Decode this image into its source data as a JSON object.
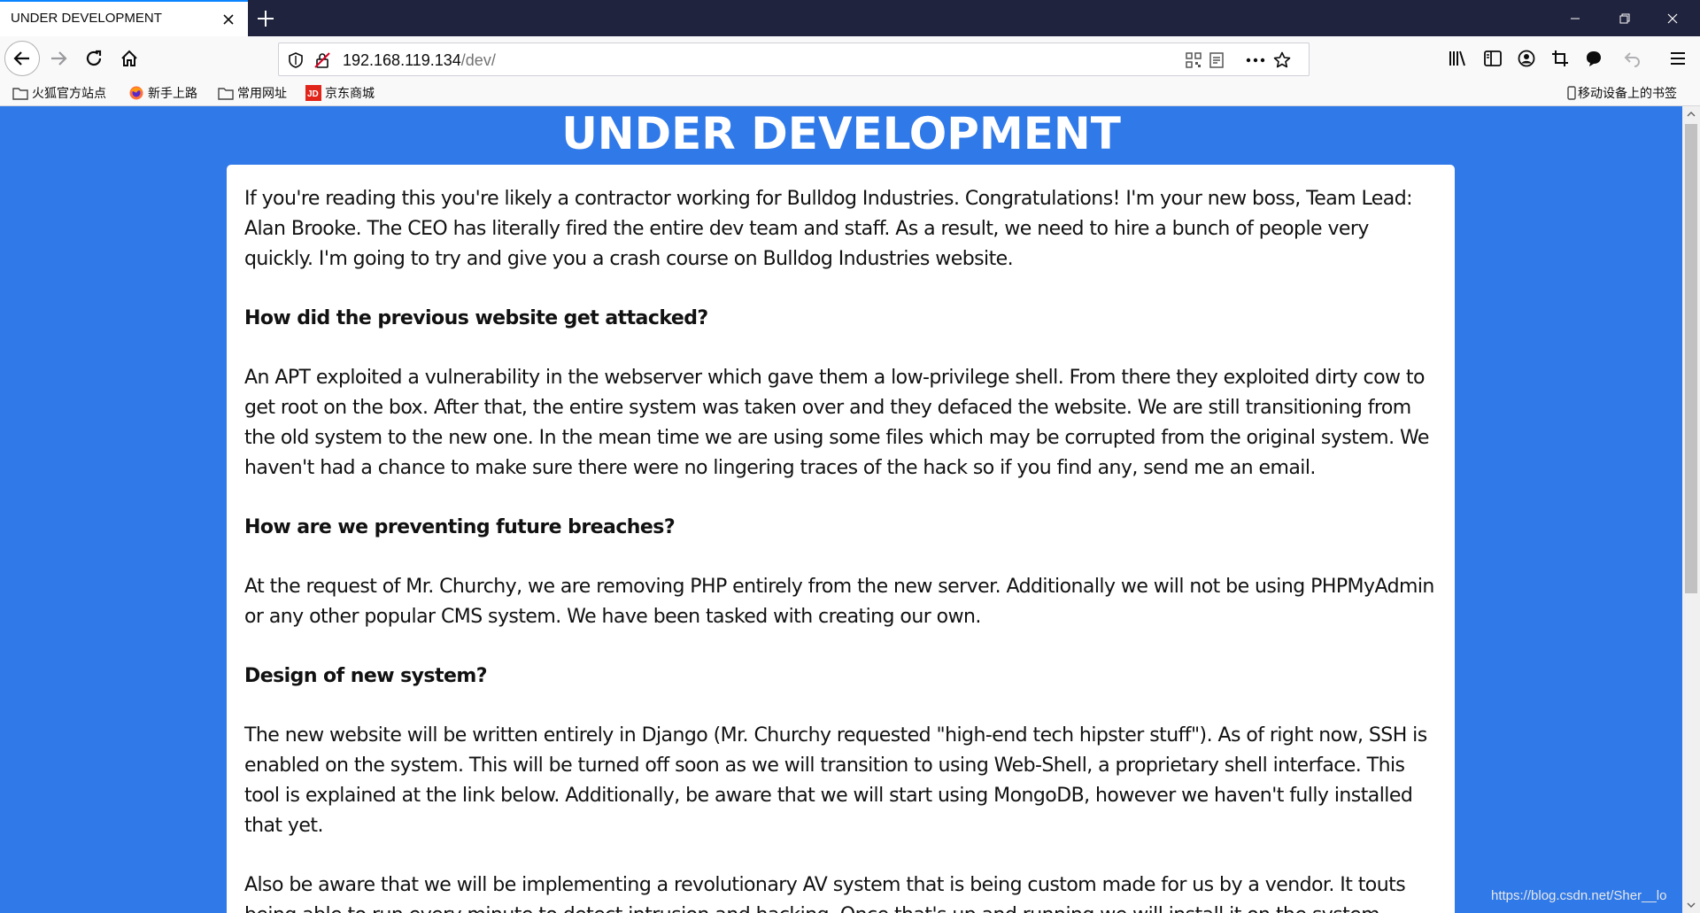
{
  "browser": {
    "tab_title": "UNDER DEVELOPMENT",
    "url_host": "192.168.119.134",
    "url_path": "/dev/"
  },
  "bookmarks": [
    {
      "label": "火狐官方站点",
      "icon": "folder-icon"
    },
    {
      "label": "新手上路",
      "icon": "firefox-icon"
    },
    {
      "label": "常用网址",
      "icon": "folder-icon"
    },
    {
      "label": "京东商城",
      "icon": "jd-icon"
    }
  ],
  "mobile_bookmarks": "移动设备上的书签",
  "page": {
    "title": "UNDER DEVELOPMENT",
    "blocks": [
      {
        "type": "p",
        "text": "If you're reading this you're likely a contractor working for Bulldog Industries. Congratulations! I'm your new boss, Team Lead: Alan Brooke. The CEO has literally fired the entire dev team and staff. As a result, we need to hire a bunch of people very quickly. I'm going to try and give you a crash course on Bulldog Industries website."
      },
      {
        "type": "h",
        "text": "How did the previous website get attacked?"
      },
      {
        "type": "p",
        "text": "An APT exploited a vulnerability in the webserver which gave them a low-privilege shell. From there they exploited dirty cow to get root on the box. After that, the entire system was taken over and they defaced the website. We are still transitioning from the old system to the new one. In the mean time we are using some files which may be corrupted from the original system. We haven't had a chance to make sure there were no lingering traces of the hack so if you find any, send me an email."
      },
      {
        "type": "h",
        "text": "How are we preventing future breaches?"
      },
      {
        "type": "p",
        "text": "At the request of Mr. Churchy, we are removing PHP entirely from the new server. Additionally we will not be using PHPMyAdmin or any other popular CMS system. We have been tasked with creating our own."
      },
      {
        "type": "h",
        "text": "Design of new system?"
      },
      {
        "type": "p",
        "text": "The new website will be written entirely in Django (Mr. Churchy requested \"high-end tech hipster stuff\"). As of right now, SSH is enabled on the system. This will be turned off soon as we will transition to using Web-Shell, a proprietary shell interface. This tool is explained at the link below. Additionally, be aware that we will start using MongoDB, however we haven't fully installed that yet."
      },
      {
        "type": "p",
        "text": "Also be aware that we will be implementing a revolutionary AV system that is being custom made for us by a vendor. It touts being able to run every minute to detect intrusion and hacking. Once that's up and running we will install it on the system."
      }
    ]
  },
  "watermark": "https://blog.csdn.net/Sher__lo",
  "colors": {
    "page_background": "#2f79e9",
    "tabstrip": "#20233d",
    "tab_accent": "#0a84ff"
  }
}
